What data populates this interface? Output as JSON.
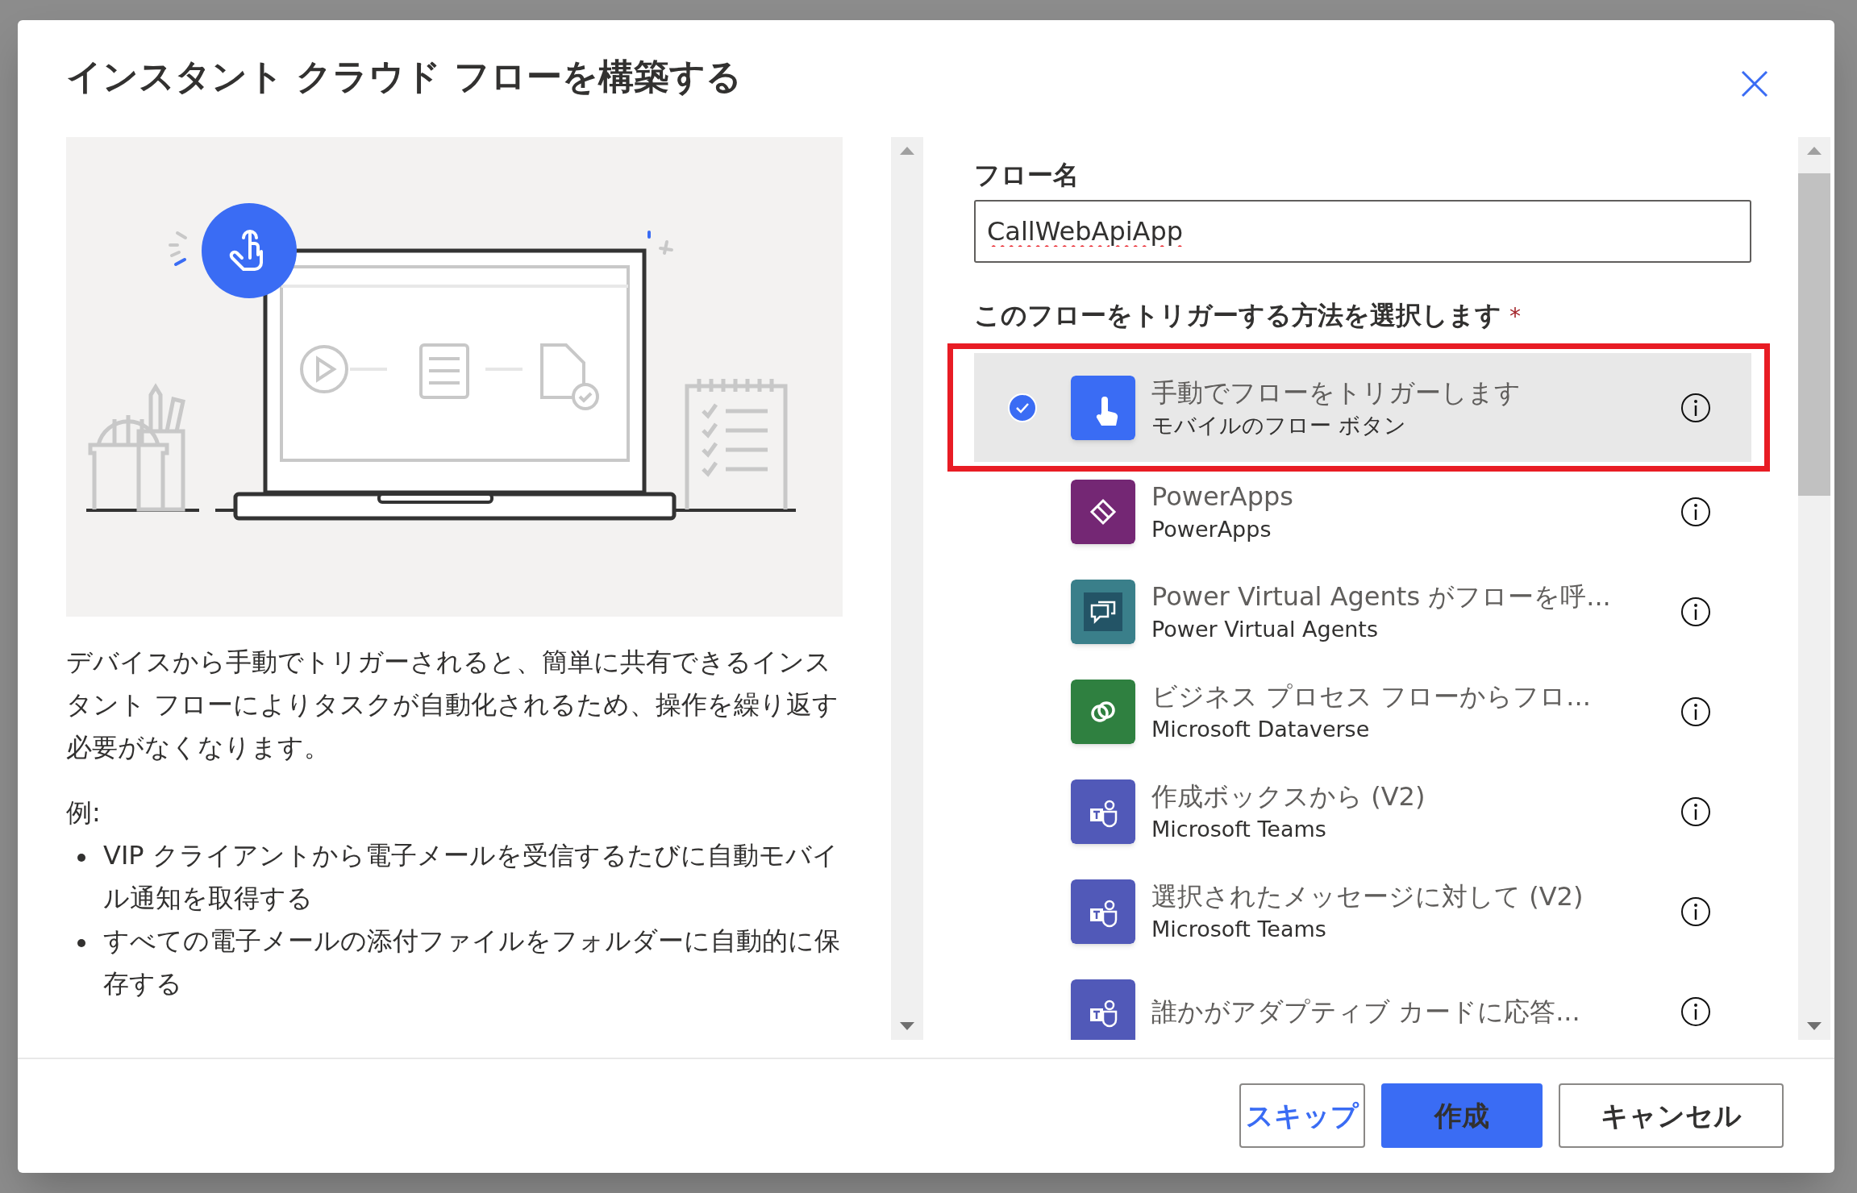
{
  "dialog": {
    "title": "インスタント クラウド フローを構築する"
  },
  "description": "デバイスから手動でトリガーされると、簡単に共有できるインスタント フローによりタスクが自動化されるため、操作を繰り返す必要がなくなります。",
  "examples_label": "例:",
  "examples": [
    "VIP クライアントから電子メールを受信するたびに自動モバイル通知を取得する",
    "すべての電子メールの添付ファイルをフォルダーに自動的に保存する"
  ],
  "flow_name": {
    "label": "フロー名",
    "value": "CallWebApiApp"
  },
  "trigger": {
    "label": "このフローをトリガーする方法を選択します",
    "required_mark": "*"
  },
  "triggers": [
    {
      "title": "手動でフローをトリガーします",
      "subtitle": "モバイルのフロー ボタン",
      "kind": "touch",
      "color": "#3a6cf4",
      "selected": true,
      "outlined": true
    },
    {
      "title": "PowerApps",
      "subtitle": "PowerApps",
      "kind": "powerapps",
      "color": "#742774",
      "selected": false,
      "outlined": false
    },
    {
      "title": "Power Virtual Agents がフローを呼...",
      "subtitle": "Power Virtual Agents",
      "kind": "pva",
      "color": "#3a7f8a",
      "selected": false,
      "outlined": false
    },
    {
      "title": "ビジネス プロセス フローからフロ...",
      "subtitle": "Microsoft Dataverse",
      "kind": "dataverse",
      "color": "#2f8040",
      "selected": false,
      "outlined": false
    },
    {
      "title": "作成ボックスから (V2)",
      "subtitle": "Microsoft Teams",
      "kind": "teams",
      "color": "#5159b8",
      "selected": false,
      "outlined": false
    },
    {
      "title": "選択されたメッセージに対して (V2)",
      "subtitle": "Microsoft Teams",
      "kind": "teams",
      "color": "#5159b8",
      "selected": false,
      "outlined": false
    },
    {
      "title": "誰かがアダプティブ カードに応答...",
      "kind": "teams",
      "color": "#5159b8",
      "selected": false,
      "outlined": false
    }
  ],
  "buttons": [
    {
      "label": "スキップ",
      "kind": "link"
    },
    {
      "label": "作成",
      "kind": "primary"
    },
    {
      "label": "キャンセル",
      "kind": "secondary"
    }
  ]
}
